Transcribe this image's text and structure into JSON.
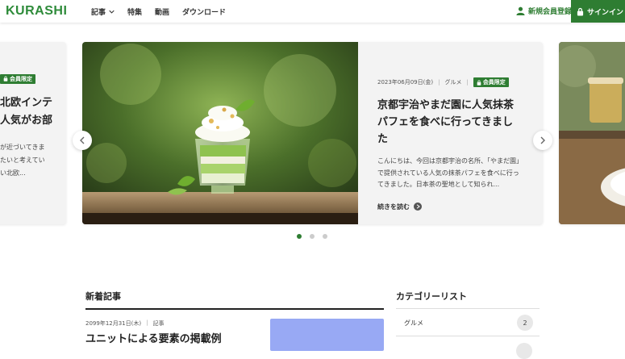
{
  "header": {
    "logo": "KURASHI",
    "nav": [
      {
        "label": "記事"
      },
      {
        "label": "特集"
      },
      {
        "label": "動画"
      },
      {
        "label": "ダウンロード"
      }
    ],
    "register_label": "新規会員登録",
    "signin_label": "サインイン",
    "accent_color": "#2e7d32"
  },
  "carousel": {
    "prev_card": {
      "badge": "会員限定",
      "title_lines": [
        "北欧インテ",
        "人気がお部"
      ],
      "desc_lines": [
        "が近づいてきま",
        "たいと考えてい",
        "い北欧..."
      ]
    },
    "main_card": {
      "date": "2023年06月09日(金)",
      "category": "グルメ",
      "badge": "会員限定",
      "title": "京都宇治やまだ園に人気抹茶パフェを食べに行ってきました",
      "desc": "こんにちは、今回は京都宇治の名所、「やまだ園」で提供されている人気の抹茶パフェを食べに行ってきました。日本茶の聖地として知られ...",
      "readmore": "続きを読む"
    },
    "pagination": {
      "total": 3,
      "active": 1
    }
  },
  "news": {
    "heading": "新着記事",
    "article": {
      "date": "2099年12月31日(木)",
      "category": "記事",
      "title": "ユニットによる要素の掲載例"
    }
  },
  "categories": {
    "heading": "カテゴリーリスト",
    "items": [
      {
        "name": "グルメ",
        "count": "2"
      }
    ]
  }
}
